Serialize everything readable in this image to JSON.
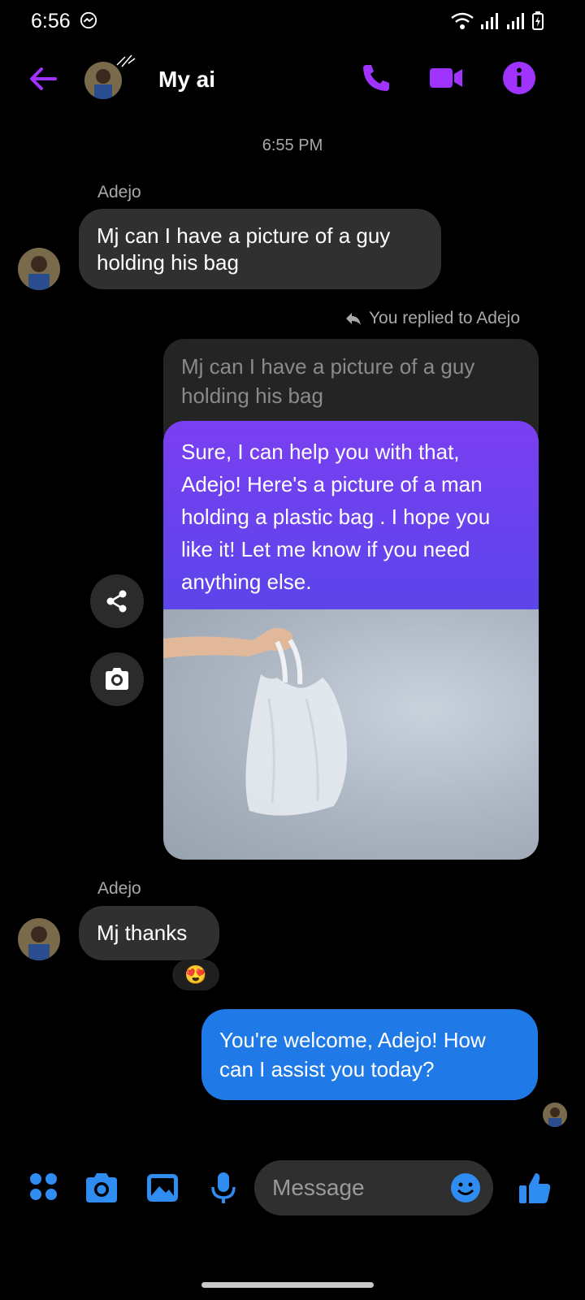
{
  "status_bar": {
    "time": "6:56"
  },
  "header": {
    "title": "My ai"
  },
  "chat": {
    "timestamp": "6:55 PM",
    "msg1": {
      "sender": "Adejo",
      "text": "Mj can I have a picture of a guy holding his bag"
    },
    "reply_note": "You replied to Adejo",
    "quoted_text": "Mj can I have a picture of a guy holding his bag",
    "ai_reply": "Sure, I can help you with that, Adejo! Here's a picture of a man holding a plastic bag  . I hope you like it! Let me know if you need anything else.",
    "msg2": {
      "sender": "Adejo",
      "text": "Mj thanks",
      "reaction": "😍"
    },
    "out_reply": "You're welcome, Adejo! How can I assist you today?"
  },
  "composer": {
    "placeholder": "Message"
  },
  "colors": {
    "accent": "#a033ff",
    "out_bubble": "#1f7ae8",
    "composer_icons": "#2f8cf0"
  }
}
